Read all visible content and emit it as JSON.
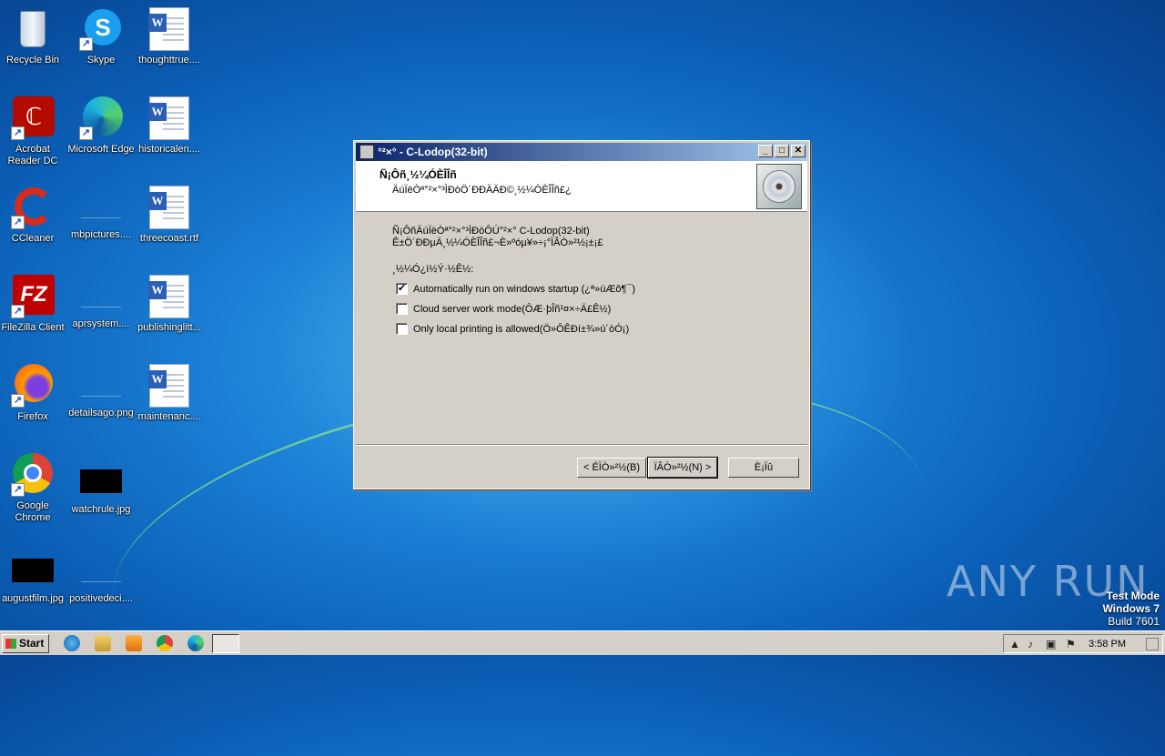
{
  "desktop": {
    "icons": [
      {
        "label": "Recycle Bin"
      },
      {
        "label": "Skype"
      },
      {
        "label": "thoughttrue...."
      },
      {
        "label": "Acrobat Reader DC"
      },
      {
        "label": "Microsoft Edge"
      },
      {
        "label": "historicalen...."
      },
      {
        "label": "CCleaner"
      },
      {
        "label": "mbpictures...."
      },
      {
        "label": "threecoast.rtf"
      },
      {
        "label": "FileZilla Client"
      },
      {
        "label": "aprsystem...."
      },
      {
        "label": "publishinglitt..."
      },
      {
        "label": "Firefox"
      },
      {
        "label": "detailsago.png"
      },
      {
        "label": "maintenanc...."
      },
      {
        "label": "Google Chrome"
      },
      {
        "label": "watchrule.jpg"
      },
      {
        "label": "augustfilm.jpg"
      },
      {
        "label": "positivedeci...."
      }
    ]
  },
  "installer": {
    "title": "°²×° - C-Lodop(32-bit)",
    "header_title": "Ñ¡Ôñ¸½¼ÓÈÎÎñ",
    "header_subtitle": "ÄúÏëÒª°²×°³ÌÐòÖ´ÐÐÄÄÐ©¸½¼ÓÈÎÎñ£¿",
    "body_line1": "Ñ¡ÔñÄúÏëÒª°²×°³ÌÐòÔÚ°²×° C-Lodop(32-bit)",
    "body_line2": "Ê±Ö´ÐÐµÄ¸½¼ÓÈÎÎñ£¬È»ºóµ¥»÷¡°ÏÂÒ»²½¡±¡£",
    "group_label": "¸½¼Ó¿ì½Ý·½Ê½:",
    "options": [
      {
        "label": "Automatically run on windows startup (¿ª»úÆô¶¯)",
        "checked": true
      },
      {
        "label": "Cloud server work mode(ÔÆ·þÎñ¹¤×÷Ä£Ê½)",
        "checked": false
      },
      {
        "label": "Only local printing is allowed(Ö»ÔÊÐí±¾»ú´òÓ¡)",
        "checked": false
      }
    ],
    "buttons": {
      "back": "< ÉÏÒ»²½(B)",
      "next": "ÏÂÒ»²½(N) >",
      "cancel": "È¡Ïû"
    }
  },
  "taskbar": {
    "start_label": "Start",
    "clock": "3:58 PM"
  },
  "watermark": {
    "brand": "ANY RUN",
    "test_mode": "Test Mode",
    "os": "Windows 7",
    "build": "Build 7601"
  }
}
